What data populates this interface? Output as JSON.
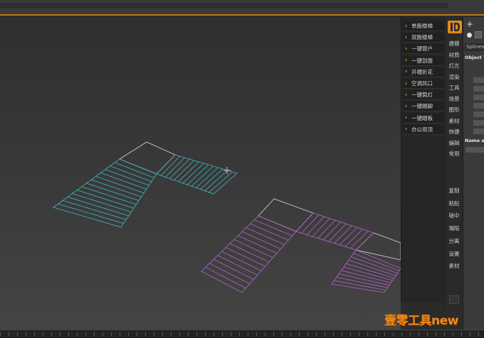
{
  "plugin_menu": {
    "items": [
      {
        "label": "单跑楼梯"
      },
      {
        "label": "双跑楼梯"
      },
      {
        "label": "一键窗户"
      },
      {
        "label": "一键剖面"
      },
      {
        "label": "开槽折花"
      },
      {
        "label": "空调风口"
      },
      {
        "label": "一键筒灯"
      },
      {
        "label": "一键踢脚"
      },
      {
        "label": "一键踏板"
      },
      {
        "label": "办公用顶"
      }
    ]
  },
  "side_tabs": {
    "upper": [
      "建模",
      "材质",
      "灯光",
      "渲染",
      "工具",
      "场景",
      "图形",
      "素材",
      "快捷",
      "编辑",
      "常用"
    ],
    "lower": [
      "复制",
      "粘贴",
      "轴中",
      "塌陷",
      "分离",
      "设置",
      "素材"
    ]
  },
  "command_panel": {
    "category": "Splines",
    "object_type": "Object Type",
    "name_and_color": "Name and Color"
  },
  "watermark": {
    "text": "壹零工具new"
  },
  "colors": {
    "accent": "#e08a1c",
    "stair_cyan": "#3fb7c4",
    "stair_magenta": "#b85fd0",
    "outline_white": "#d8d8d8"
  }
}
